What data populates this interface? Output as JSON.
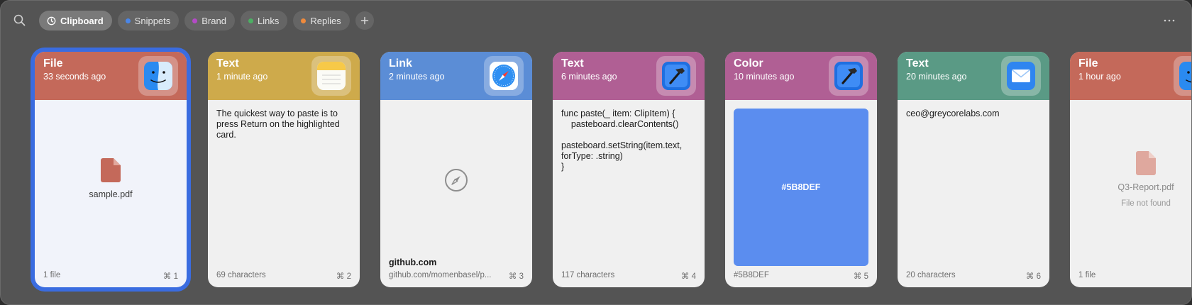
{
  "toolbar": {
    "search_icon": "magnifier-icon",
    "more_icon": "ellipsis-icon",
    "add_icon": "plus-icon",
    "tabs": [
      {
        "label": "Clipboard",
        "active": true,
        "icon": "clock-icon"
      },
      {
        "label": "Snippets",
        "color": "#4a86e8"
      },
      {
        "label": "Brand",
        "color": "#b44ac6"
      },
      {
        "label": "Links",
        "color": "#4caf63"
      },
      {
        "label": "Replies",
        "color": "#ef8a3c"
      }
    ]
  },
  "cards": [
    {
      "type": "File",
      "time": "33 seconds ago",
      "header_color": "#c4695a",
      "app_icon": "finder-icon",
      "file_name": "sample.pdf",
      "footer_left": "1 file",
      "shortcut": "⌘ 1",
      "selected": true
    },
    {
      "type": "Text",
      "time": "1 minute ago",
      "header_color": "#ceaa4b",
      "app_icon": "notes-icon",
      "text": "The quickest way to paste is to press Return on the highlighted card.",
      "footer_left": "69 characters",
      "shortcut": "⌘ 2"
    },
    {
      "type": "Link",
      "time": "2 minutes ago",
      "header_color": "#5b8dd6",
      "app_icon": "safari-icon",
      "link_title": "github.com",
      "footer_left": "github.com/momenbasel/p...",
      "shortcut": "⌘ 3"
    },
    {
      "type": "Text",
      "time": "6 minutes ago",
      "header_color": "#b05f94",
      "app_icon": "xcode-icon",
      "text": "func paste(_ item: ClipItem) {\n    pasteboard.clearContents()\n\npasteboard.setString(item.text,\nforType: .string)\n}",
      "footer_left": "117 characters",
      "shortcut": "⌘ 4"
    },
    {
      "type": "Color",
      "time": "10 minutes ago",
      "header_color": "#b05f94",
      "app_icon": "xcode-icon",
      "swatch_color": "#5B8DEF",
      "swatch_label": "#5B8DEF",
      "footer_left": "#5B8DEF",
      "shortcut": "⌘ 5"
    },
    {
      "type": "Text",
      "time": "20 minutes ago",
      "header_color": "#5a9a85",
      "app_icon": "mail-icon",
      "text": "ceo@greycorelabs.com",
      "footer_left": "20 characters",
      "shortcut": "⌘ 6"
    },
    {
      "type": "File",
      "time": "1 hour ago",
      "header_color": "#c4695a",
      "app_icon": "finder-icon",
      "file_name": "Q3-Report.pdf",
      "file_note": "File not found",
      "footer_left": "1 file"
    }
  ]
}
